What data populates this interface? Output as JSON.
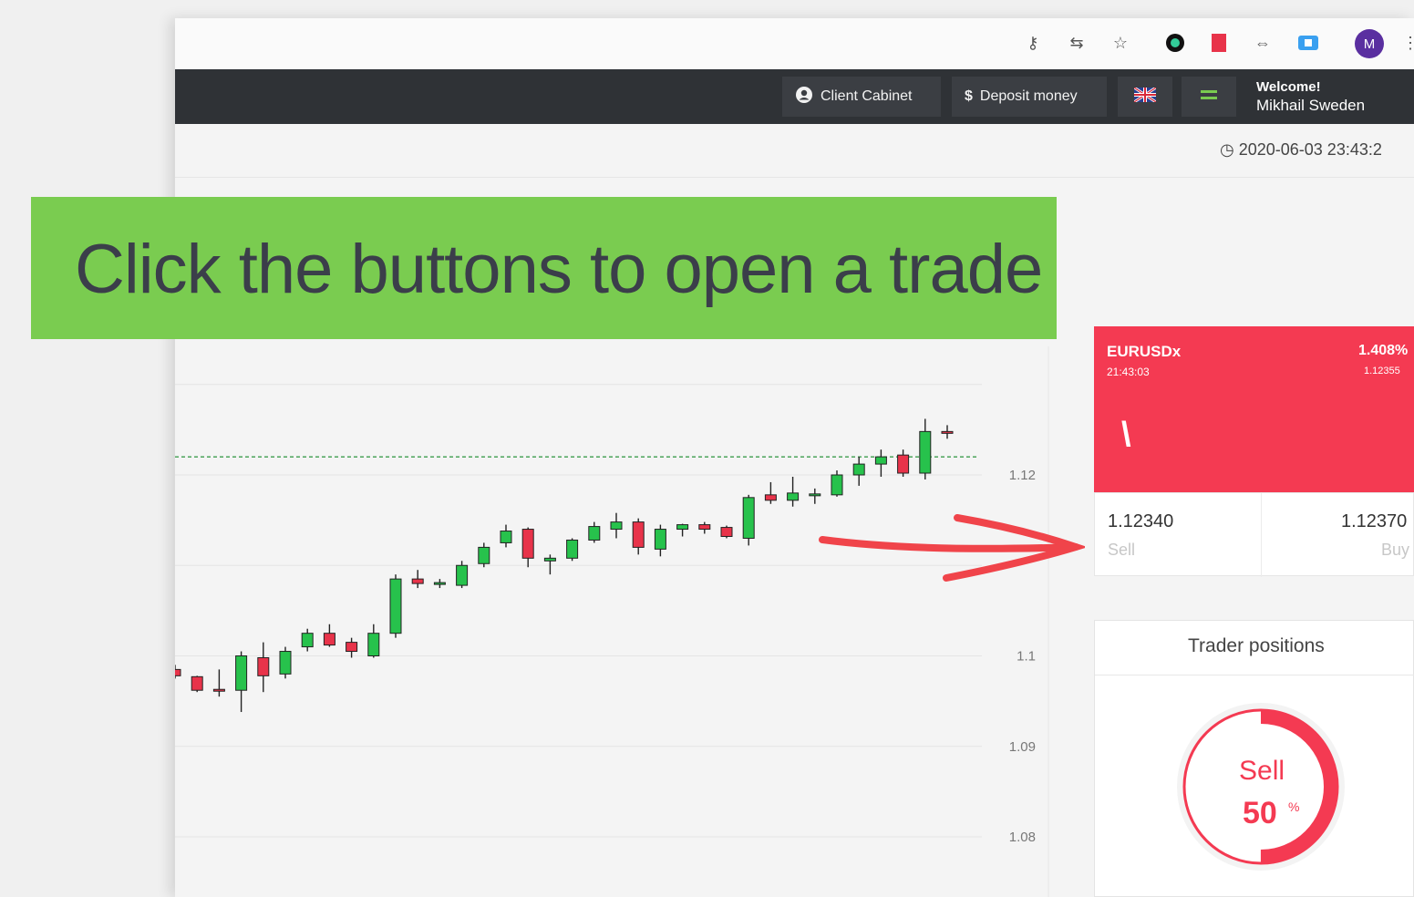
{
  "navbar": {
    "client_cabinet": "Client Cabinet",
    "deposit_money": "Deposit money",
    "welcome_line1": "Welcome!",
    "welcome_line2": "Mikhail Sweden"
  },
  "avatar_letter": "M",
  "datetime": "2020-06-03 23:43:2",
  "banner": {
    "text": "Click the buttons to open a trade"
  },
  "ticker": {
    "symbol": "EURUSDx",
    "time": "21:43:03",
    "change_pct": "1.408%",
    "sub_value": "1.12355",
    "trend_glyph": "\\"
  },
  "quotes": {
    "sell_price": "1.12340",
    "sell_label": "Sell",
    "buy_price": "1.12370",
    "buy_label": "Buy"
  },
  "positions": {
    "title": "Trader positions",
    "sell_label": "Sell",
    "sell_value": "50",
    "sell_unit": "%",
    "sell_fraction": 0.5
  },
  "colors": {
    "accent_red": "#f43a52",
    "accent_green": "#7acc50",
    "candle_up": "#27c24c",
    "candle_down": "#e8334a"
  },
  "chart_data": {
    "type": "candlestick",
    "y_tick_labels": [
      "1.12",
      "1.1",
      "1.09",
      "1.08"
    ],
    "y_ticks": [
      1.12,
      1.1,
      1.09,
      1.08
    ],
    "ylim": [
      1.075,
      1.13
    ],
    "current_price_line": 1.122,
    "series": [
      {
        "o": 1.0985,
        "h": 1.099,
        "l": 1.0975,
        "c": 1.0978
      },
      {
        "o": 1.0977,
        "h": 1.0978,
        "l": 1.096,
        "c": 1.0962
      },
      {
        "o": 1.0963,
        "h": 1.0985,
        "l": 1.0955,
        "c": 1.0962
      },
      {
        "o": 1.0962,
        "h": 1.1005,
        "l": 1.0938,
        "c": 1.1
      },
      {
        "o": 1.0998,
        "h": 1.1015,
        "l": 1.096,
        "c": 1.0978
      },
      {
        "o": 1.098,
        "h": 1.101,
        "l": 1.0975,
        "c": 1.1005
      },
      {
        "o": 1.101,
        "h": 1.103,
        "l": 1.1005,
        "c": 1.1025
      },
      {
        "o": 1.1025,
        "h": 1.1035,
        "l": 1.101,
        "c": 1.1012
      },
      {
        "o": 1.1015,
        "h": 1.102,
        "l": 1.0998,
        "c": 1.1005
      },
      {
        "o": 1.1,
        "h": 1.1035,
        "l": 1.0998,
        "c": 1.1025
      },
      {
        "o": 1.1025,
        "h": 1.109,
        "l": 1.102,
        "c": 1.1085
      },
      {
        "o": 1.1085,
        "h": 1.1095,
        "l": 1.1075,
        "c": 1.108
      },
      {
        "o": 1.108,
        "h": 1.1085,
        "l": 1.1075,
        "c": 1.1081
      },
      {
        "o": 1.1078,
        "h": 1.1105,
        "l": 1.1075,
        "c": 1.11
      },
      {
        "o": 1.1102,
        "h": 1.1125,
        "l": 1.1098,
        "c": 1.112
      },
      {
        "o": 1.1125,
        "h": 1.1145,
        "l": 1.112,
        "c": 1.1138
      },
      {
        "o": 1.114,
        "h": 1.1142,
        "l": 1.1098,
        "c": 1.1108
      },
      {
        "o": 1.1105,
        "h": 1.1112,
        "l": 1.109,
        "c": 1.1108
      },
      {
        "o": 1.1108,
        "h": 1.113,
        "l": 1.1105,
        "c": 1.1128
      },
      {
        "o": 1.1128,
        "h": 1.1148,
        "l": 1.1125,
        "c": 1.1143
      },
      {
        "o": 1.114,
        "h": 1.1158,
        "l": 1.113,
        "c": 1.1148
      },
      {
        "o": 1.1148,
        "h": 1.1152,
        "l": 1.1112,
        "c": 1.112
      },
      {
        "o": 1.1118,
        "h": 1.1145,
        "l": 1.111,
        "c": 1.114
      },
      {
        "o": 1.114,
        "h": 1.1146,
        "l": 1.1132,
        "c": 1.1145
      },
      {
        "o": 1.1145,
        "h": 1.1148,
        "l": 1.1135,
        "c": 1.114
      },
      {
        "o": 1.1142,
        "h": 1.1144,
        "l": 1.113,
        "c": 1.1132
      },
      {
        "o": 1.113,
        "h": 1.1178,
        "l": 1.1122,
        "c": 1.1175
      },
      {
        "o": 1.1178,
        "h": 1.1192,
        "l": 1.1168,
        "c": 1.1172
      },
      {
        "o": 1.1172,
        "h": 1.1198,
        "l": 1.1165,
        "c": 1.118
      },
      {
        "o": 1.1178,
        "h": 1.1185,
        "l": 1.1168,
        "c": 1.1179
      },
      {
        "o": 1.1178,
        "h": 1.1205,
        "l": 1.1176,
        "c": 1.12
      },
      {
        "o": 1.12,
        "h": 1.122,
        "l": 1.1188,
        "c": 1.1212
      },
      {
        "o": 1.1212,
        "h": 1.1228,
        "l": 1.1198,
        "c": 1.122
      },
      {
        "o": 1.1222,
        "h": 1.1228,
        "l": 1.1198,
        "c": 1.1202
      },
      {
        "o": 1.1202,
        "h": 1.1262,
        "l": 1.1195,
        "c": 1.1248
      },
      {
        "o": 1.1248,
        "h": 1.1255,
        "l": 1.124,
        "c": 1.1247
      }
    ]
  }
}
